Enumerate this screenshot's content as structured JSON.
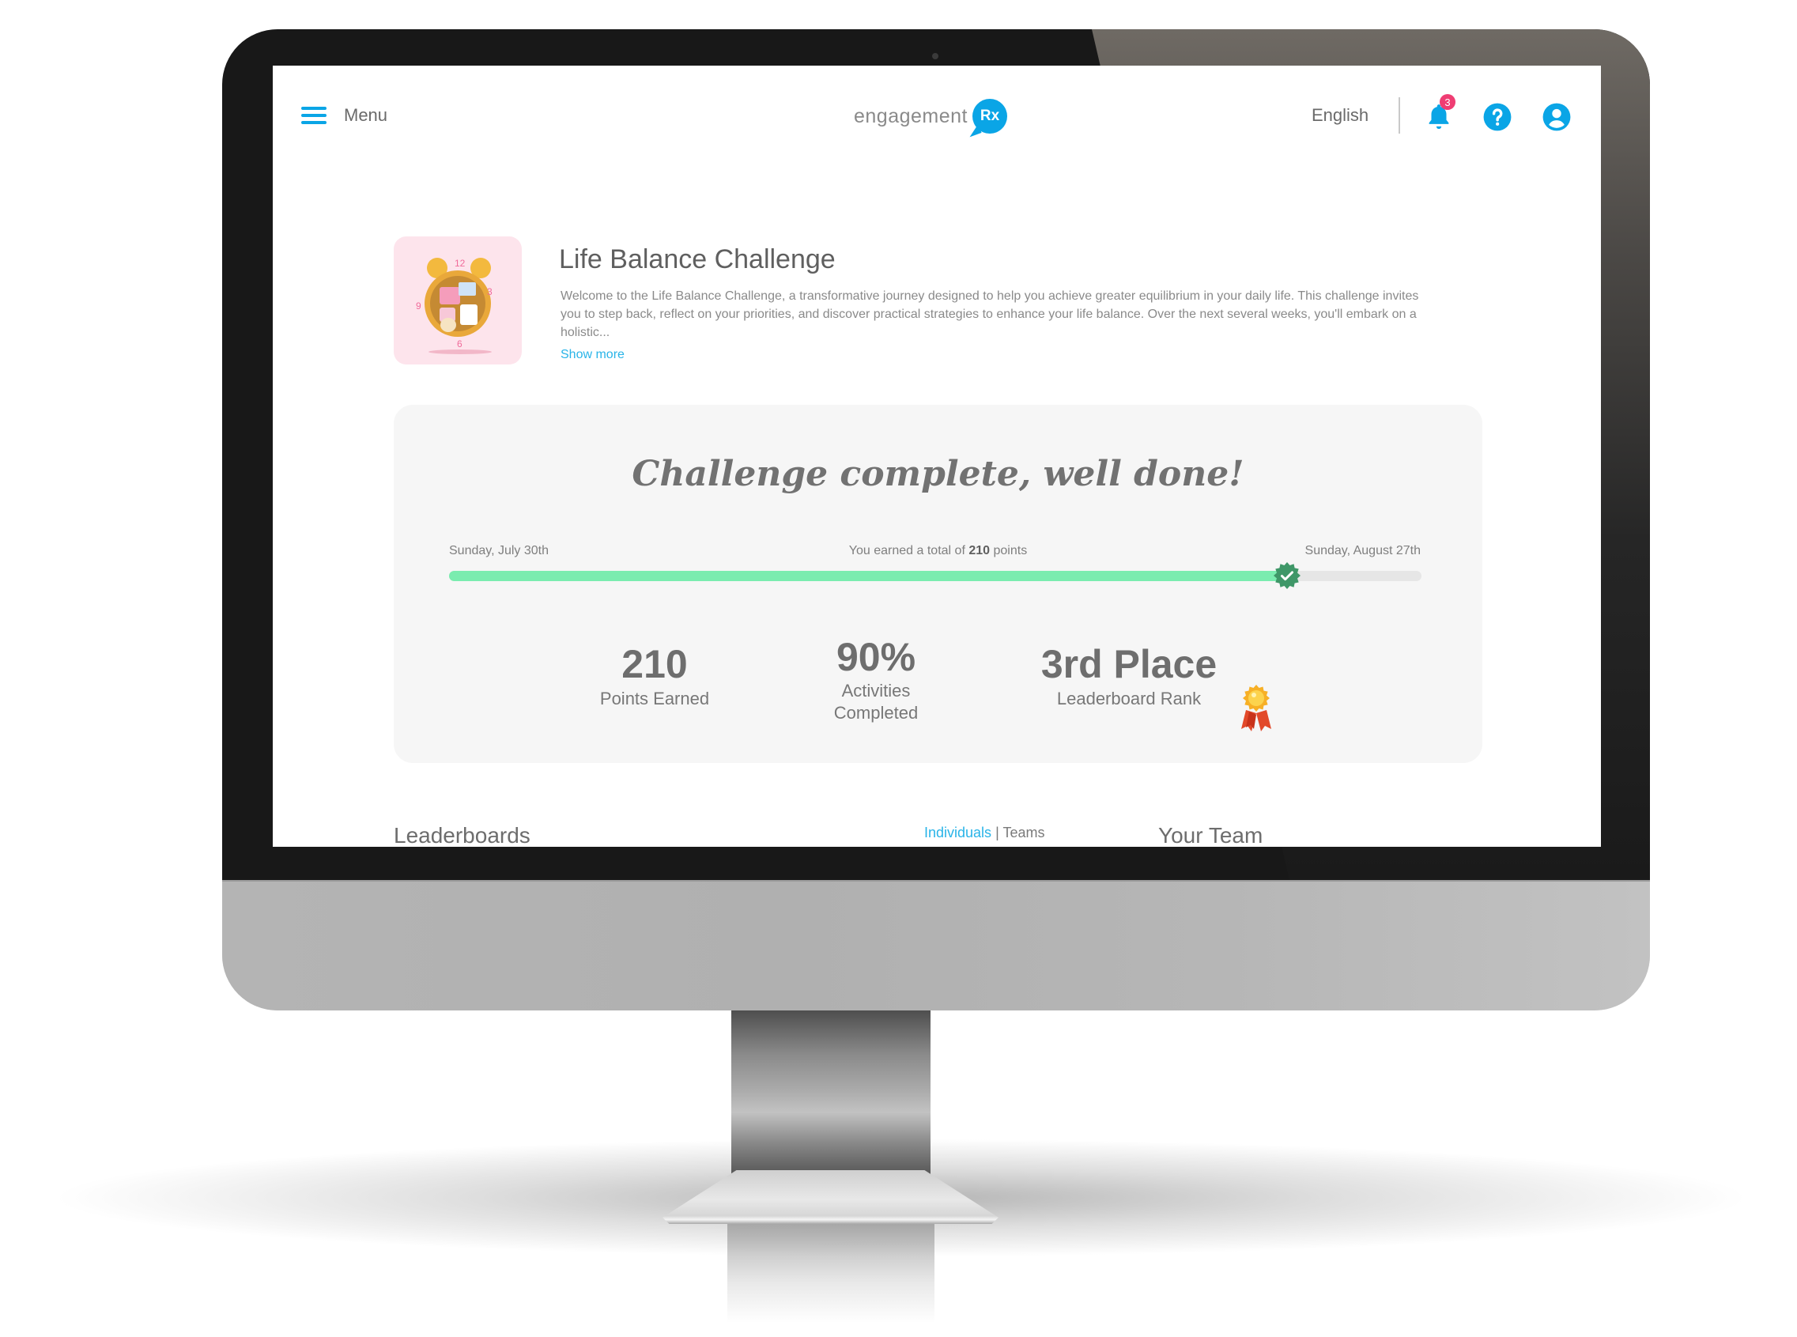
{
  "header": {
    "menu_label": "Menu",
    "logo_text": "engagement",
    "logo_badge": "Rx",
    "language": "English",
    "notification_count": "3",
    "icons": [
      "hamburger-icon",
      "bell-icon",
      "help-icon",
      "user-icon"
    ]
  },
  "challenge": {
    "title": "Life Balance Challenge",
    "description": "Welcome to the Life Balance Challenge, a transformative journey designed to help you achieve greater equilibrium in your daily life. This challenge invites you to step back, reflect on your priorities, and discover practical strategies to enhance your life balance. Over the next several weeks, you'll embark on a holistic...",
    "show_more": "Show more",
    "thumbnail": "alarm-clock-illustration",
    "clock_numbers": [
      "12",
      "3",
      "6",
      "9"
    ]
  },
  "completion": {
    "heading": "Challenge complete, well done!",
    "start_date": "Sunday, July 30th",
    "end_date": "Sunday, August 27th",
    "summary_prefix": "You earned a total of",
    "summary_points": "210",
    "summary_suffix": "points",
    "progress_fraction": 0.862,
    "colors": {
      "progress_fill": "#7aecaf",
      "marker": "#3f9768"
    },
    "stats": {
      "points_value": "210",
      "points_label": "Points Earned",
      "activities_value": "90%",
      "activities_label_1": "Activities",
      "activities_label_2": "Completed",
      "rank_value": "3rd Place",
      "rank_label": "Leaderboard Rank"
    }
  },
  "leaderboards": {
    "title": "Leaderboards",
    "tab_individuals": "Individuals",
    "tab_separator": "|",
    "tab_teams": "Teams",
    "team_title": "Your Team"
  },
  "theme": {
    "accent": "#0aa5e6",
    "badge": "#ef3d73",
    "link": "#29b4e8"
  }
}
